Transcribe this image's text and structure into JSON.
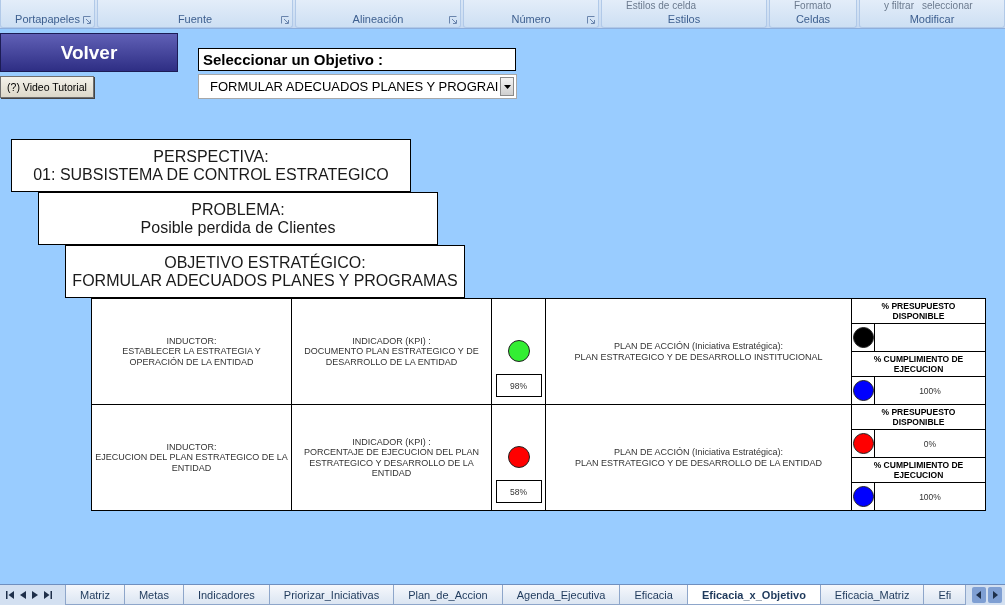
{
  "ribbon": {
    "groups": [
      {
        "label": "Portapapeles",
        "launcher": true
      },
      {
        "label": "Fuente",
        "launcher": true
      },
      {
        "label": "Alineación",
        "launcher": true
      },
      {
        "label": "Número",
        "launcher": true
      },
      {
        "label": "Estilos",
        "launcher": false,
        "items": [
          "Estilos de celda"
        ]
      },
      {
        "label": "Celdas",
        "launcher": false,
        "items": [
          "Formato"
        ]
      },
      {
        "label": "Modificar",
        "launcher": false,
        "items": [
          "y filtrar",
          "seleccionar"
        ]
      }
    ]
  },
  "back_button": "Volver",
  "tutorial_button": "(?) Video Tutorial",
  "objective_selector": {
    "label": "Seleccionar un Objetivo :",
    "value": "FORMULAR ADECUADOS PLANES Y PROGRAI"
  },
  "hierarchy": [
    {
      "label": "PERSPECTIVA:",
      "value": "01: SUBSISTEMA DE CONTROL ESTRATEGICO"
    },
    {
      "label": "PROBLEMA:",
      "value": "Posible perdida de Clientes"
    },
    {
      "label": "OBJETIVO ESTRATÉGICO:",
      "value": "FORMULAR ADECUADOS PLANES Y PROGRAMAS"
    }
  ],
  "rows": [
    {
      "inductor": {
        "label": "INDUCTOR:",
        "value": "ESTABLECER LA ESTRATEGIA Y OPERACIÓN DE LA ENTIDAD"
      },
      "indicator": {
        "label": "INDICADOR (KPI) :",
        "value": "DOCUMENTO PLAN ESTRATEGICO Y DE DESARROLLO DE LA ENTIDAD"
      },
      "semaphore": {
        "color": "#33ee33",
        "value": "98%"
      },
      "action_plan": {
        "label": "PLAN DE ACCIÓN (Iniciativa Estratégica):",
        "value": "PLAN ESTRATEGICO Y DE DESARROLLO INSTITUCIONAL"
      },
      "metrics": [
        {
          "label": "% PRESUPUESTO DISPONIBLE",
          "color": "#000000"
        },
        {
          "label": "% CUMPLIMIENTO DE EJECUCION",
          "color": "#0000ff",
          "value": "100%"
        }
      ]
    },
    {
      "inductor": {
        "label": "INDUCTOR:",
        "value": "EJECUCION DEL PLAN ESTRATEGICO DE LA ENTIDAD"
      },
      "indicator": {
        "label": "INDICADOR (KPI) :",
        "value": "PORCENTAJE DE EJECUCION DEL PLAN ESTRATEGICO Y DESARROLLO DE LA ENTIDAD"
      },
      "semaphore": {
        "color": "#ff0000",
        "value": "58%"
      },
      "action_plan": {
        "label": "PLAN DE ACCIÓN (Iniciativa Estratégica):",
        "value": "PLAN ESTRATEGICO Y DE DESARROLLO DE LA ENTIDAD"
      },
      "metrics": [
        {
          "label": "% PRESUPUESTO DISPONIBLE",
          "color": "#ff0000",
          "value": "0%"
        },
        {
          "label": "% CUMPLIMIENTO DE EJECUCION",
          "color": "#0000ff",
          "value": "100%"
        }
      ]
    }
  ],
  "sheet_tabs": [
    {
      "label": "Matriz",
      "selected": false
    },
    {
      "label": "Metas",
      "selected": false
    },
    {
      "label": "Indicadores",
      "selected": false
    },
    {
      "label": "Priorizar_Iniciativas",
      "selected": false
    },
    {
      "label": "Plan_de_Accion",
      "selected": false
    },
    {
      "label": "Agenda_Ejecutiva",
      "selected": false
    },
    {
      "label": "Eficacia",
      "selected": false
    },
    {
      "label": "Eficacia_x_Objetivo",
      "selected": true
    },
    {
      "label": "Eficacia_Matriz",
      "selected": false
    },
    {
      "label": "Efi",
      "selected": false
    }
  ]
}
